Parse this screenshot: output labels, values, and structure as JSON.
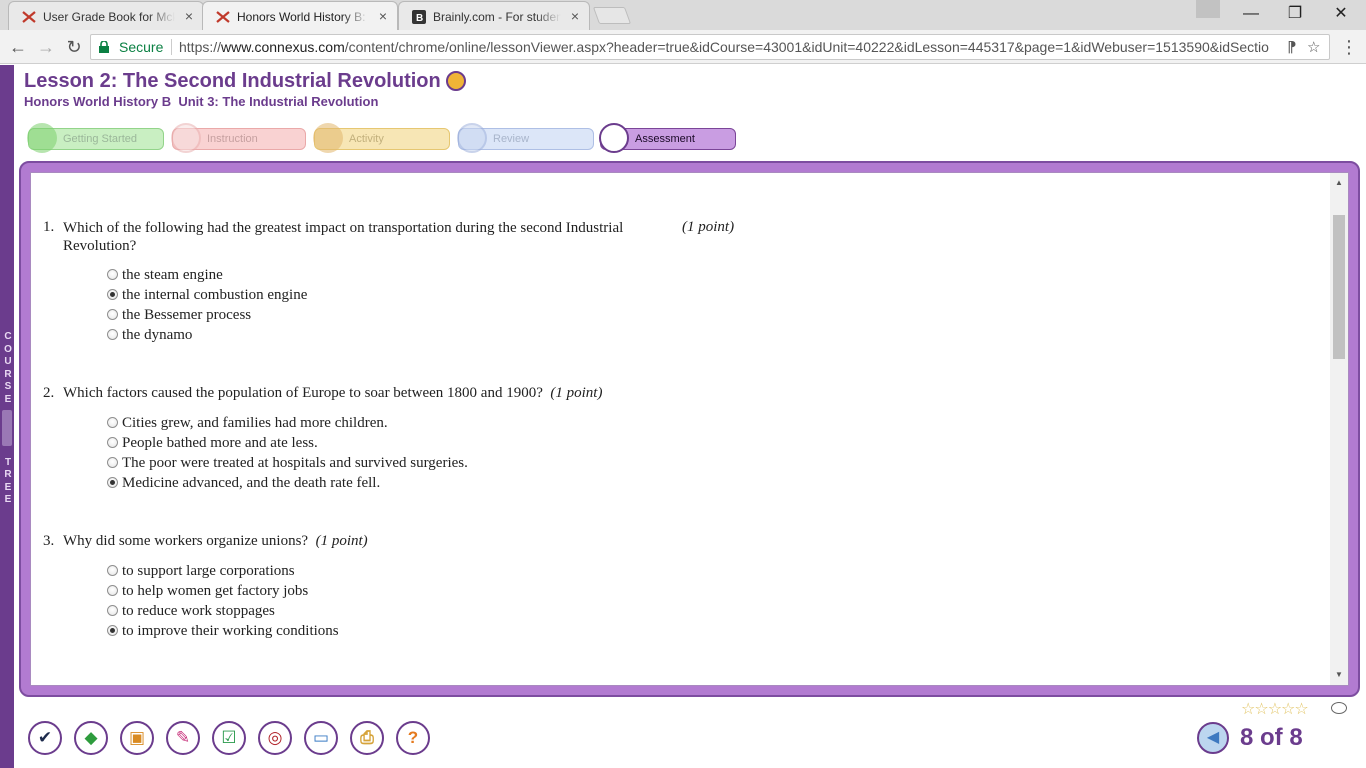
{
  "browser": {
    "tabs": [
      {
        "title": "User Grade Book for Mck",
        "close": "×"
      },
      {
        "title": "Honors World History B: ",
        "close": "×"
      },
      {
        "title": "Brainly.com - For student",
        "close": "×"
      }
    ],
    "window_buttons": {
      "minimize": "—",
      "maximize": "❐",
      "close": "✕"
    },
    "nav": {
      "back": "←",
      "forward": "→",
      "reload": "↻"
    },
    "secure_label": "Secure",
    "url_prefix": "https://",
    "url_host": "www.connexus.com",
    "url_path": "/content/chrome/online/lessonViewer.aspx?header=true&idCourse=43001&idUnit=40222&idLesson=445317&page=1&idWebuser=1513590&idSectio",
    "omni_icons": {
      "pin": "⁋",
      "star": "☆"
    },
    "menu": "⋮"
  },
  "sidebar": {
    "label": "COURSE TREE",
    "letters": [
      "C",
      "O",
      "U",
      "R",
      "S",
      "E",
      "",
      "",
      "",
      "",
      "",
      "T",
      "R",
      "E",
      "E"
    ]
  },
  "lesson": {
    "title": "Lesson 2: The Second Industrial Revolution",
    "subtitle": "Honors World History B  Unit 3: The Industrial Revolution"
  },
  "phases": {
    "getting_started": "Getting Started",
    "instruction": "Instruction",
    "activity": "Activity",
    "review": "Review",
    "assessment": "Assessment"
  },
  "questions": [
    {
      "number": "1.",
      "text": "Which of the following had the greatest impact on transportation during the second Industrial Revolution?",
      "points": "(1 point)",
      "options": [
        "the steam engine",
        "the internal combustion engine",
        "the Bessemer process",
        "the dynamo"
      ],
      "selected": 1
    },
    {
      "number": "2.",
      "text": "Which factors caused the population of Europe to soar between 1800 and 1900?",
      "points": "(1 point)",
      "options": [
        "Cities grew, and families had more children.",
        "People bathed more and ate less.",
        "The poor were treated at hospitals and survived surgeries.",
        "Medicine advanced, and the death rate fell."
      ],
      "selected": 3
    },
    {
      "number": "3.",
      "text": "Why did some workers organize unions?",
      "points": "(1 point)",
      "options": [
        "to support large corporations",
        "to help women get factory jobs",
        "to reduce work stoppages",
        "to improve their working conditions"
      ],
      "selected": 3
    }
  ],
  "tools": [
    {
      "icon": "checkmark-icon",
      "glyph": "✔",
      "color": "#1d2b4d"
    },
    {
      "icon": "book-icon",
      "glyph": "◆",
      "color": "#2e9c3d"
    },
    {
      "icon": "briefcase-icon",
      "glyph": "▣",
      "color": "#d98b23"
    },
    {
      "icon": "pushpin-icon",
      "glyph": "✎",
      "color": "#c8347d"
    },
    {
      "icon": "checklist-icon",
      "glyph": "☑",
      "color": "#2a9a4c"
    },
    {
      "icon": "target-icon",
      "glyph": "◎",
      "color": "#b2232a"
    },
    {
      "icon": "monitor-icon",
      "glyph": "▭",
      "color": "#3a7bc4"
    },
    {
      "icon": "printer-icon",
      "glyph": "⎙",
      "color": "#d6a33a"
    },
    {
      "icon": "help-icon",
      "glyph": "?",
      "color": "#e57a1e"
    }
  ],
  "rating": {
    "stars": "☆☆☆☆☆"
  },
  "pagination": {
    "prev_glyph": "◀",
    "label": "8 of 8"
  }
}
